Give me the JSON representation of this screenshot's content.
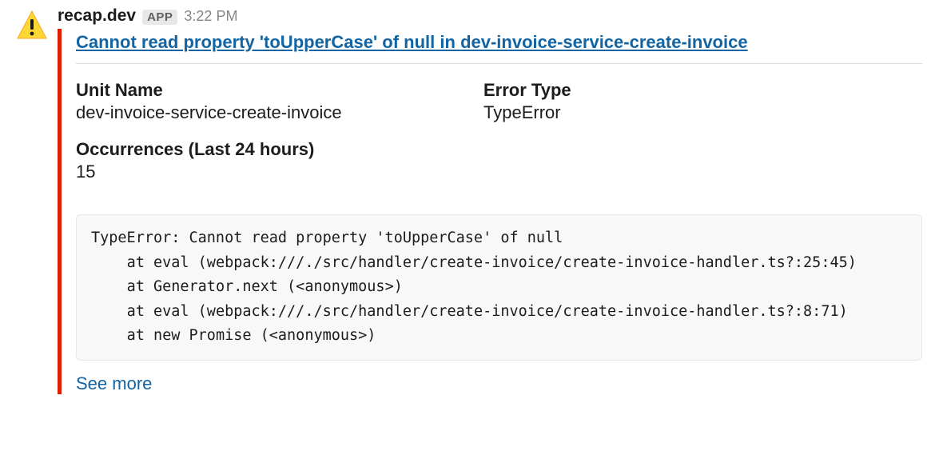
{
  "message": {
    "sender": "recap.dev",
    "appBadge": "APP",
    "timestamp": "3:22 PM"
  },
  "attachment": {
    "barColor": "#e01e00",
    "title": {
      "main": "Cannot read property 'toUpperCase' of null",
      "connector": " in ",
      "context": "dev-invoice-service-create-invoice"
    },
    "fields": {
      "unitName": {
        "label": "Unit Name",
        "value": "dev-invoice-service-create-invoice"
      },
      "errorType": {
        "label": "Error Type",
        "value": "TypeError"
      },
      "occurrences": {
        "label": "Occurrences (Last 24 hours)",
        "value": "15"
      }
    },
    "stacktrace": "TypeError: Cannot read property 'toUpperCase' of null\n    at eval (webpack:///./src/handler/create-invoice/create-invoice-handler.ts?:25:45)\n    at Generator.next (<anonymous>)\n    at eval (webpack:///./src/handler/create-invoice/create-invoice-handler.ts?:8:71)\n    at new Promise (<anonymous>)",
    "seeMore": "See more"
  }
}
